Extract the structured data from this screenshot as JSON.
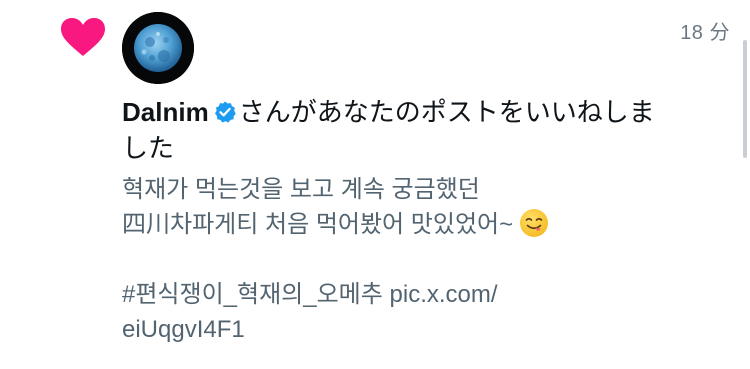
{
  "notification": {
    "timestamp": "18 分",
    "user": {
      "display_name": "Dalnim",
      "verified": true,
      "badge_color": "#1d9bf0"
    },
    "action_text_1": "さんがあなたのポストをいいねしま",
    "action_text_2": "した",
    "icon": "heart-icon",
    "icon_color": "#f91880",
    "post": {
      "line1": "혁재가 먹는것을 보고 계속 궁금했던",
      "line2": "四川차파게티 처음 먹어봤어 맛있었어~",
      "line3": "#편식쟁이_혁재의_오메추 pic.x.com/",
      "line4": "eiUqgvI4F1",
      "emoji": "face-savoring-food-emoji"
    }
  },
  "colors": {
    "secondary_text": "#536471",
    "primary_text": "#0f1419",
    "timestamp": "#6b7781"
  }
}
